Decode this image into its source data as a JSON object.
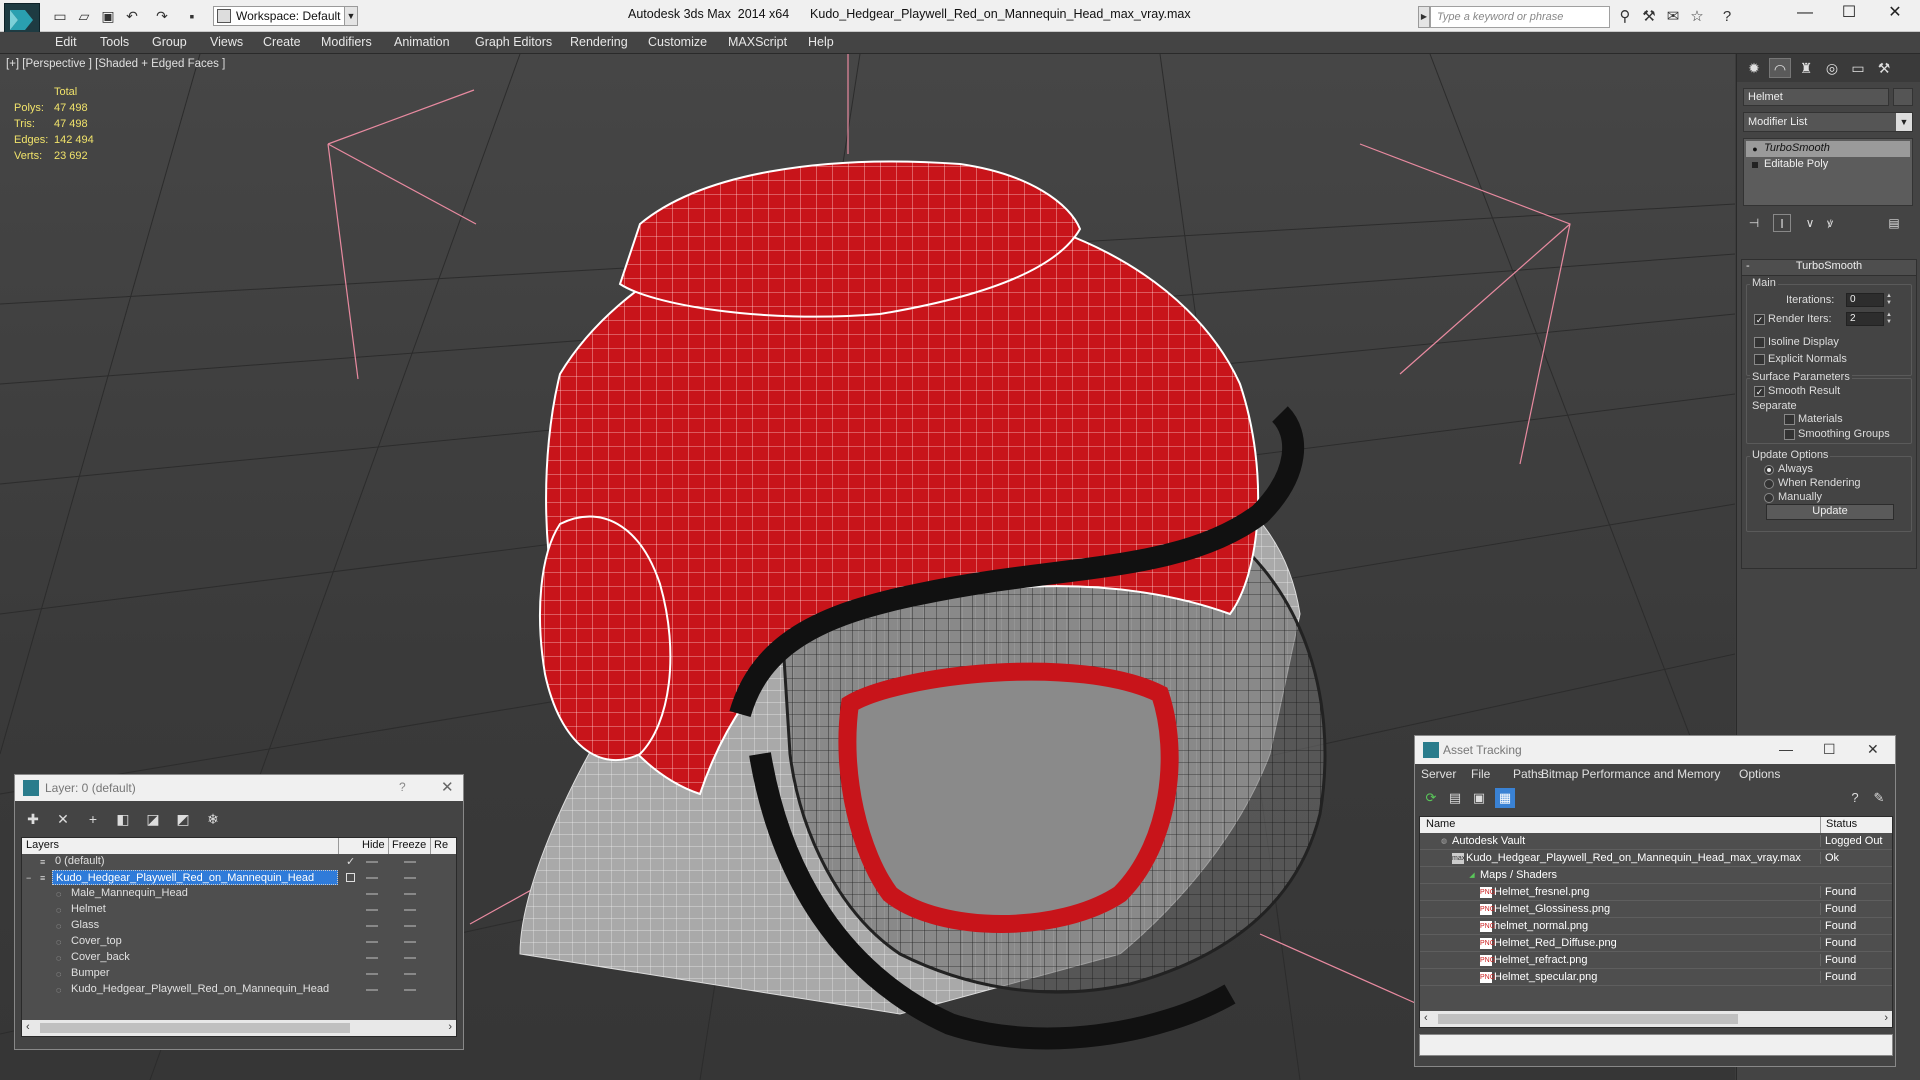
{
  "titlebar": {
    "workspace": "Workspace: Default",
    "title": "Autodesk 3ds Max  2014 x64      Kudo_Hedgear_Playwell_Red_on_Mannequin_Head_max_vray.max",
    "search_placeholder": "Type a keyword or phrase"
  },
  "menu": [
    "Edit",
    "Tools",
    "Group",
    "Views",
    "Create",
    "Modifiers",
    "Animation",
    "Graph Editors",
    "Rendering",
    "Customize",
    "MAXScript",
    "Help"
  ],
  "viewport": {
    "label": "[+] [Perspective ] [Shaded + Edged Faces ]",
    "stats": {
      "total_label": "Total",
      "rows": [
        {
          "k": "Polys:",
          "v": "47 498"
        },
        {
          "k": "Tris:",
          "v": "47 498"
        },
        {
          "k": "Edges:",
          "v": "142 494"
        },
        {
          "k": "Verts:",
          "v": "23 692"
        }
      ]
    }
  },
  "command_panel": {
    "object_name": "Helmet",
    "modifier_list": "Modifier List",
    "stack": [
      "TurboSmooth",
      "Editable Poly"
    ],
    "rollout": {
      "title": "TurboSmooth",
      "main": "Main",
      "iterations_label": "Iterations:",
      "iterations": "0",
      "render_iters_label": "Render Iters:",
      "render_iters": "2",
      "isoline": "Isoline Display",
      "explicit": "Explicit Normals",
      "surface": "Surface Parameters",
      "smooth_result": "Smooth Result",
      "separate": "Separate",
      "materials": "Materials",
      "smoothing_groups": "Smoothing Groups",
      "update_options": "Update Options",
      "always": "Always",
      "when_rendering": "When Rendering",
      "manually": "Manually",
      "update_btn": "Update"
    }
  },
  "layer_window": {
    "title": "Layer: 0 (default)",
    "help": "?",
    "columns": [
      "Layers",
      "Hide",
      "Freeze",
      "Re"
    ],
    "rows": [
      "0 (default)",
      "Kudo_Hedgear_Playwell_Red_on_Mannequin_Head",
      "Male_Mannequin_Head",
      "Helmet",
      "Glass",
      "Cover_top",
      "Cover_back",
      "Bumper",
      "Kudo_Hedgear_Playwell_Red_on_Mannequin_Head"
    ]
  },
  "asset_tracking": {
    "title": "Asset Tracking",
    "menu": [
      "Server",
      "File",
      "Paths",
      "Bitmap Performance and Memory",
      "Options"
    ],
    "columns": [
      "Name",
      "Status"
    ],
    "rows": [
      {
        "name": "Autodesk Vault",
        "status": "Logged Out"
      },
      {
        "name": "Kudo_Hedgear_Playwell_Red_on_Mannequin_Head_max_vray.max",
        "status": "Ok"
      },
      {
        "name": "Maps / Shaders",
        "status": ""
      },
      {
        "name": "Helmet_fresnel.png",
        "status": "Found"
      },
      {
        "name": "Helmet_Glossiness.png",
        "status": "Found"
      },
      {
        "name": "helmet_normal.png",
        "status": "Found"
      },
      {
        "name": "Helmet_Red_Diffuse.png",
        "status": "Found"
      },
      {
        "name": "Helmet_refract.png",
        "status": "Found"
      },
      {
        "name": "Helmet_specular.png",
        "status": "Found"
      }
    ]
  },
  "colors": {
    "accent": "#2f7bd9",
    "helmet_red": "#c8141a",
    "stats_yellow": "#f0e26a"
  }
}
